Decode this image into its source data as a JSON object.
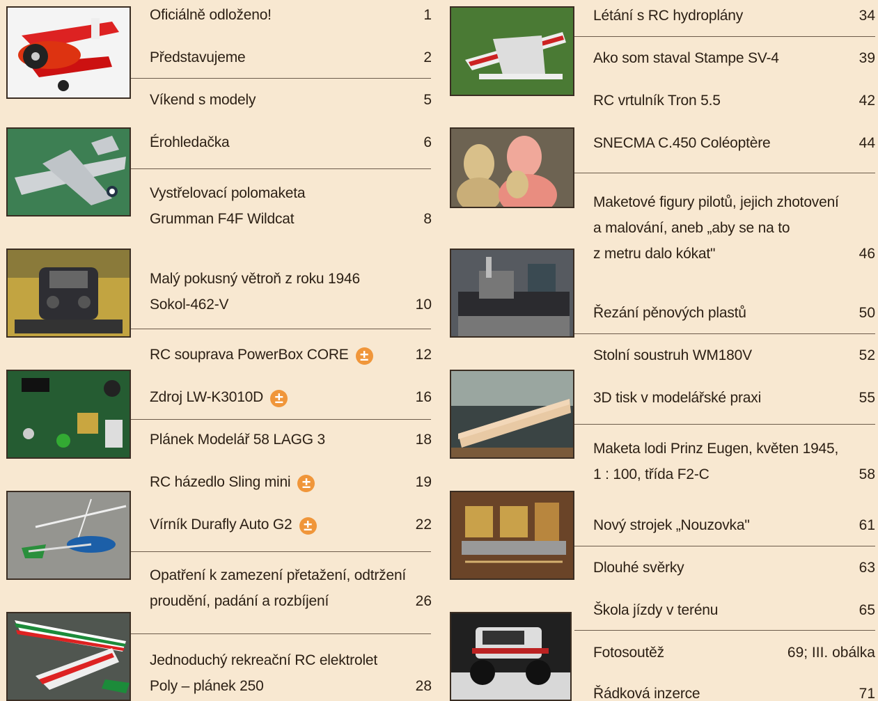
{
  "left_column": [
    {
      "lines": [
        "Oficiálně odloženo!"
      ],
      "page": "1"
    },
    {
      "lines": [
        "Představujeme"
      ],
      "page": "2"
    },
    {
      "lines": [
        "Víkend s modely"
      ],
      "page": "5"
    },
    {
      "lines": [
        "Érohledačka"
      ],
      "page": "6"
    },
    {
      "lines": [
        "Vystřelovací polomaketa",
        "Grumman F4F Wildcat"
      ],
      "page": "8"
    },
    {
      "lines": [
        "Malý pokusný větroň z roku 1946",
        "Sokol-462-V"
      ],
      "page": "10"
    },
    {
      "lines": [
        "RC souprava PowerBox CORE"
      ],
      "page": "12",
      "plus": "±"
    },
    {
      "lines": [
        "Zdroj LW-K3010D"
      ],
      "page": "16",
      "plus": "±"
    },
    {
      "lines": [
        "Plánek Modelář 58 LAGG 3"
      ],
      "page": "18"
    },
    {
      "lines": [
        "RC házedlo Sling mini"
      ],
      "page": "19",
      "plus": "±"
    },
    {
      "lines": [
        "Vírník Durafly Auto G2"
      ],
      "page": "22",
      "plus": "±"
    },
    {
      "lines": [
        "Opatření k zamezení přetažení, odtržení",
        "proudění, padání a rozbíjení"
      ],
      "page": "26"
    },
    {
      "lines": [
        "Jednoduchý rekreační RC elektrolet",
        "Poly – plánek 250"
      ],
      "page": "28"
    }
  ],
  "right_column": [
    {
      "lines": [
        "Létání s RC hydroplány"
      ],
      "page": "34"
    },
    {
      "lines": [
        "Ako som staval Stampe SV-4"
      ],
      "page": "39"
    },
    {
      "lines": [
        "RC vrtulník Tron 5.5"
      ],
      "page": "42"
    },
    {
      "lines": [
        "SNECMA C.450 Coléoptère"
      ],
      "page": "44"
    },
    {
      "lines": [
        "Maketové figury pilotů, jejich zhotovení",
        "a malování, aneb „aby se na to",
        "z metru dalo kókat\""
      ],
      "page": "46"
    },
    {
      "lines": [
        "Řezání pěnových plastů"
      ],
      "page": "50"
    },
    {
      "lines": [
        "Stolní soustruh WM180V"
      ],
      "page": "52"
    },
    {
      "lines": [
        "3D tisk v modelářské praxi"
      ],
      "page": "55"
    },
    {
      "lines": [
        "Maketa lodi Prinz Eugen, květen 1945,",
        "1 : 100, třída F2-C"
      ],
      "page": "58"
    },
    {
      "lines": [
        "Nový strojek „Nouzovka\""
      ],
      "page": "61"
    },
    {
      "lines": [
        "Dlouhé svěrky"
      ],
      "page": "63"
    },
    {
      "lines": [
        "Škola jízdy v terénu"
      ],
      "page": "65"
    },
    {
      "lines": [
        "Fotosoutěž"
      ],
      "page": "69; III. obálka"
    },
    {
      "lines": [
        "Řádková inzerce"
      ],
      "page": "71"
    }
  ],
  "images": [
    {
      "icon": "red-racer-airplane-photo"
    },
    {
      "icon": "grey-fighter-plane-photo"
    },
    {
      "icon": "rc-transmitter-photo"
    },
    {
      "icon": "circuit-board-photo"
    },
    {
      "icon": "autogyro-model-photo"
    },
    {
      "icon": "italian-livery-airplane-photo"
    },
    {
      "icon": "seaplane-model-photo"
    },
    {
      "icon": "pilot-figures-photo"
    },
    {
      "icon": "lathe-photo"
    },
    {
      "icon": "ship-hull-model-photo"
    },
    {
      "icon": "engine-model-photo"
    },
    {
      "icon": "rc-truck-photo"
    }
  ],
  "colors": {
    "background": "#f8e8d1",
    "plus_badge": "#f0963a",
    "rule": "#6b5a49"
  }
}
